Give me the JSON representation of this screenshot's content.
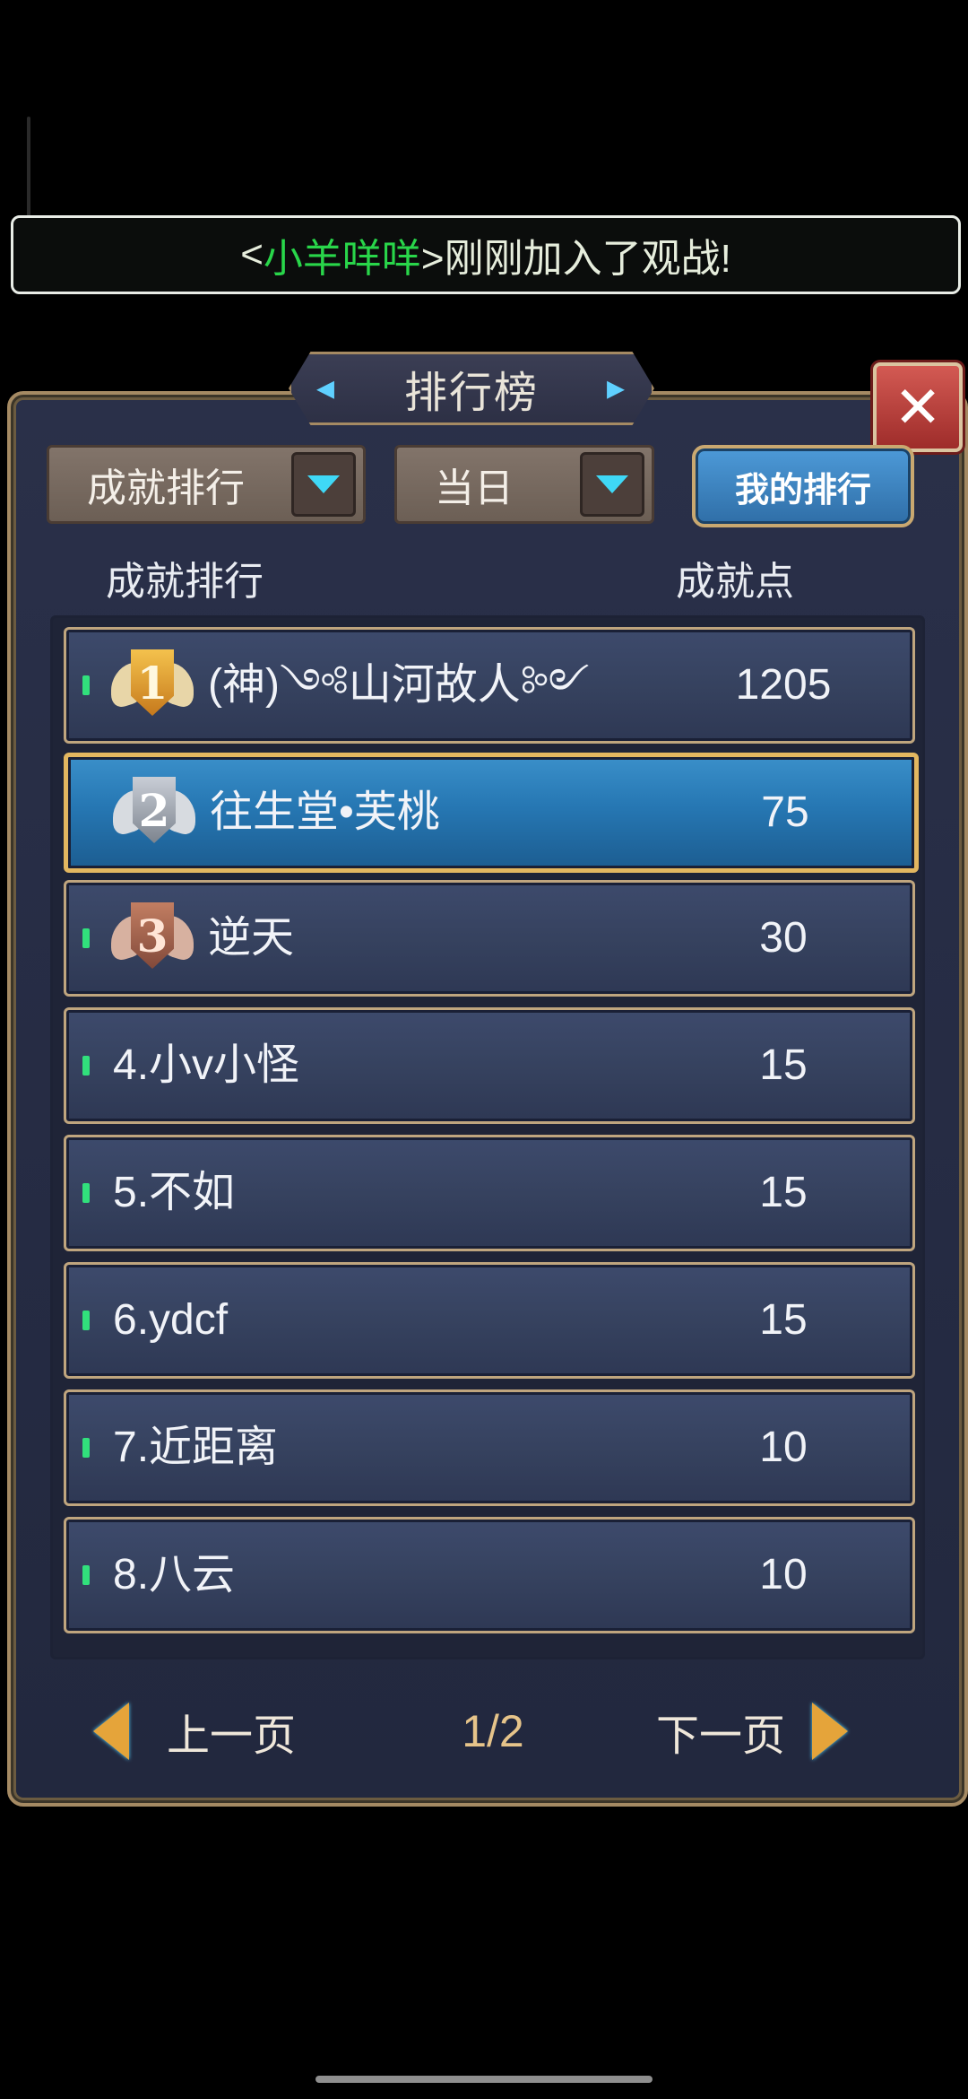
{
  "notice": {
    "prefix": "<",
    "player": "小羊咩咩",
    "suffix": ">刚刚加入了观战!"
  },
  "panel": {
    "title": "排行榜",
    "close_label": "✕"
  },
  "filters": {
    "category": "成就排行",
    "period": "当日",
    "my_rank_label": "我的排行"
  },
  "columns": {
    "name": "成就排行",
    "points": "成就点"
  },
  "rows": [
    {
      "rank": 1,
      "name": "(神)༺山河故人༻",
      "points": "1205",
      "badge": "1"
    },
    {
      "rank": 2,
      "name": "往生堂•芙桃",
      "points": "75",
      "badge": "2",
      "selected": true
    },
    {
      "rank": 3,
      "name": "逆天",
      "points": "30",
      "badge": "3"
    },
    {
      "rank": 4,
      "name": "4.小v小怪",
      "points": "15"
    },
    {
      "rank": 5,
      "name": "5.不如",
      "points": "15"
    },
    {
      "rank": 6,
      "name": "6.ydcf",
      "points": "15"
    },
    {
      "rank": 7,
      "name": "7.近距离",
      "points": "10"
    },
    {
      "rank": 8,
      "name": "8.八云",
      "points": "10"
    }
  ],
  "pager": {
    "prev": "上一页",
    "page": "1/2",
    "next": "下一页"
  },
  "icons": {
    "caret": "dropdown-caret-icon",
    "close": "close-icon",
    "prev": "left-arrow-icon",
    "next": "right-arrow-icon"
  },
  "colors": {
    "accent": "#3fd8f6",
    "player_name": "#29d64a",
    "selected_border": "#e3b760"
  }
}
